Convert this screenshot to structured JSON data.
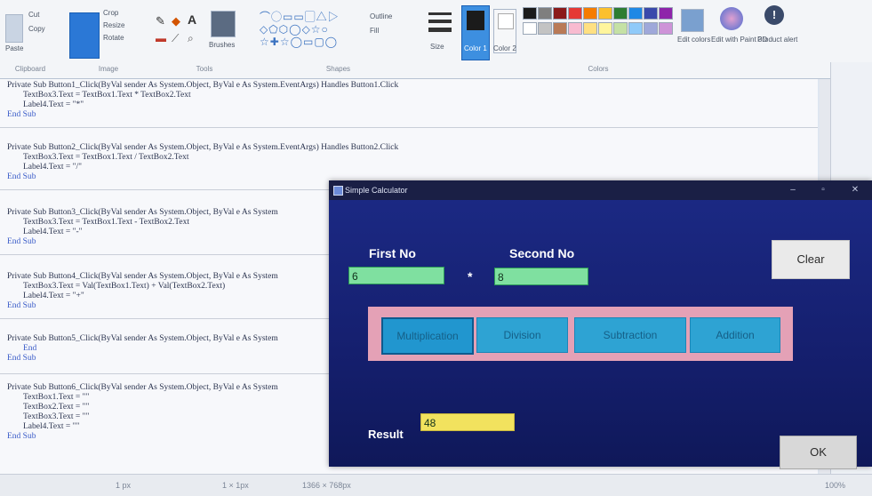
{
  "ribbon": {
    "groups": [
      "Clipboard",
      "Image",
      "Tools",
      "Shapes",
      "Colors"
    ],
    "clipboard": {
      "paste": "Paste",
      "cut": "Cut",
      "copy": "Copy"
    },
    "image": {
      "select": "Select",
      "crop": "Crop",
      "resize": "Resize",
      "rotate": "Rotate"
    },
    "tools_brushes": "Brushes",
    "shapes": {
      "outline": "Outline",
      "fill": "Fill"
    },
    "size": "Size",
    "color1": "Color 1",
    "color2": "Color 2",
    "edit_colors": "Edit colors",
    "edit_paint3d": "Edit with Paint 3D",
    "product_alert": "Product alert",
    "palette": [
      "#1b1b1b",
      "#7f7f7f",
      "#8b1a1a",
      "#e53935",
      "#f57c00",
      "#fbc02d",
      "#2e7d32",
      "#1e88e5",
      "#3949ab",
      "#8e24aa",
      "#ffffff",
      "#c3c3c3",
      "#b97a57",
      "#f8bbd0",
      "#ffe082",
      "#fff59d",
      "#c5e1a5",
      "#90caf9",
      "#9fa8da",
      "#ce93d8"
    ]
  },
  "code_blocks": [
    {
      "lines": [
        "Private Sub Button1_Click(ByVal sender As System.Object, ByVal e As System.EventArgs) Handles Button1.Click",
        "TextBox3.Text = TextBox1.Text * TextBox2.Text",
        "Label4.Text = \"*\"",
        "End Sub"
      ]
    },
    {
      "lines": [
        "Private Sub Button2_Click(ByVal sender As System.Object, ByVal e As System.EventArgs) Handles Button2.Click",
        "TextBox3.Text = TextBox1.Text / TextBox2.Text",
        "Label4.Text = \"/\"",
        "End Sub"
      ]
    },
    {
      "lines": [
        "Private Sub Button3_Click(ByVal sender As System.Object, ByVal e As System",
        "TextBox3.Text = TextBox1.Text - TextBox2.Text",
        "Label4.Text = \"-\"",
        "End Sub"
      ]
    },
    {
      "lines": [
        "Private Sub Button4_Click(ByVal sender As System.Object, ByVal e As System",
        "TextBox3.Text = Val(TextBox1.Text) + Val(TextBox2.Text)",
        "Label4.Text = \"+\"",
        "End Sub"
      ]
    },
    {
      "lines": [
        "Private Sub Button5_Click(ByVal sender As System.Object, ByVal e As System",
        "End",
        "End Sub"
      ]
    },
    {
      "lines": [
        "Private Sub Button6_Click(ByVal sender As System.Object, ByVal e As System",
        "TextBox1.Text = \"\"",
        "TextBox2.Text = \"\"",
        "TextBox3.Text = \"\"",
        "Label4.Text = \"\"",
        "End Sub"
      ]
    }
  ],
  "status": {
    "position": "1 px",
    "selection": "1 × 1px",
    "size": "1366 × 768px",
    "zoom": "100%"
  },
  "calc": {
    "title": "Simple Calculator",
    "first_label": "First No",
    "second_label": "Second No",
    "first_value": "6",
    "second_value": "8",
    "operator": "*",
    "clear": "Clear",
    "buttons": [
      "Multiplication",
      "Division",
      "Subtraction",
      "Addition"
    ],
    "result_label": "Result",
    "result_value": "48",
    "ok": "OK",
    "colors": {
      "field_green": "#7fe0a0",
      "result_yellow": "#f2e25e",
      "panel_pink": "#e4a1b6",
      "button_blue": "#2ea3d3"
    }
  }
}
